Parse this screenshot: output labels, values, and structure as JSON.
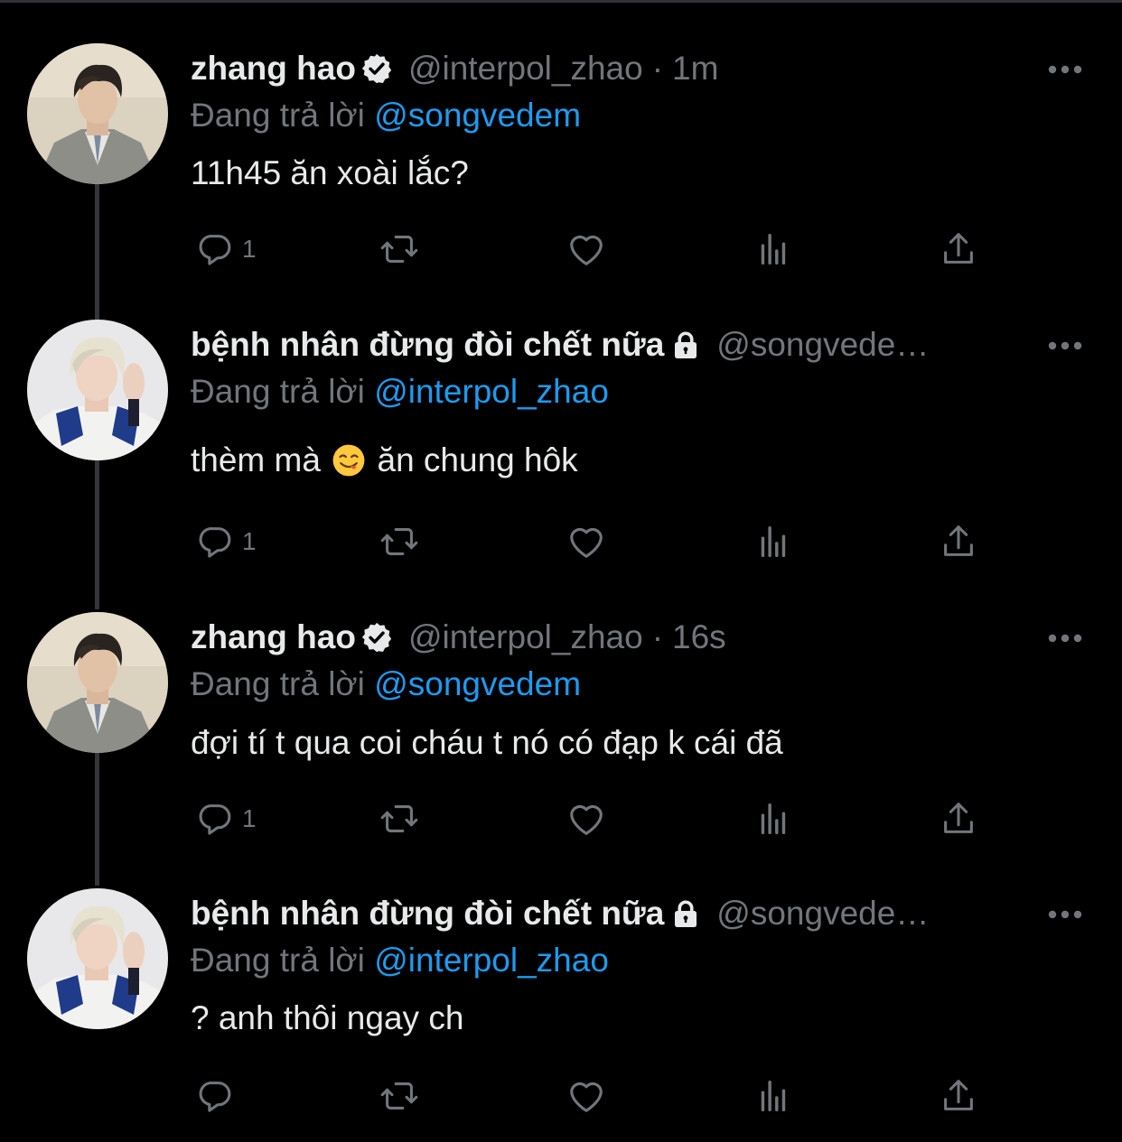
{
  "tweets": [
    {
      "name": "zhang hao",
      "verified": true,
      "protected": false,
      "handle": "@interpol_zhao",
      "time": "1m",
      "replying_prefix": "Đang trả lời ",
      "replying_to": "@songvedem",
      "text": "11h45 ăn xoài lắc?",
      "text_after_emoji": "",
      "reply_count": "1"
    },
    {
      "name": "bệnh nhân đừng đòi chết nữa",
      "verified": false,
      "protected": true,
      "handle": "@songvede…",
      "time": "",
      "replying_prefix": "Đang trả lời ",
      "replying_to": "@interpol_zhao",
      "text": "thèm mà",
      "emoji": "savoring-food-emoji",
      "text_after_emoji": "ăn chung hôk",
      "reply_count": "1"
    },
    {
      "name": "zhang hao",
      "verified": true,
      "protected": false,
      "handle": "@interpol_zhao",
      "time": "16s",
      "replying_prefix": "Đang trả lời ",
      "replying_to": "@songvedem",
      "text": "đợi tí t qua coi cháu t nó có đạp k cái đã",
      "text_after_emoji": "",
      "reply_count": "1"
    },
    {
      "name": "bệnh nhân đừng đòi chết nữa",
      "verified": false,
      "protected": true,
      "handle": "@songvede…",
      "time": "",
      "replying_prefix": "Đang trả lời ",
      "replying_to": "@interpol_zhao",
      "text": "? anh thôi ngay ch",
      "text_after_emoji": "",
      "reply_count": ""
    }
  ],
  "icons": {
    "reply": "reply-icon",
    "retweet": "retweet-icon",
    "like": "heart-icon",
    "views": "analytics-icon",
    "share": "share-icon",
    "more": "more-icon",
    "verified": "verified-badge-icon",
    "protected": "lock-icon"
  },
  "colors": {
    "background": "#000000",
    "text": "#e7e9ea",
    "secondary": "#71767b",
    "mention": "#1d9bf0",
    "thread_line": "#333639"
  }
}
